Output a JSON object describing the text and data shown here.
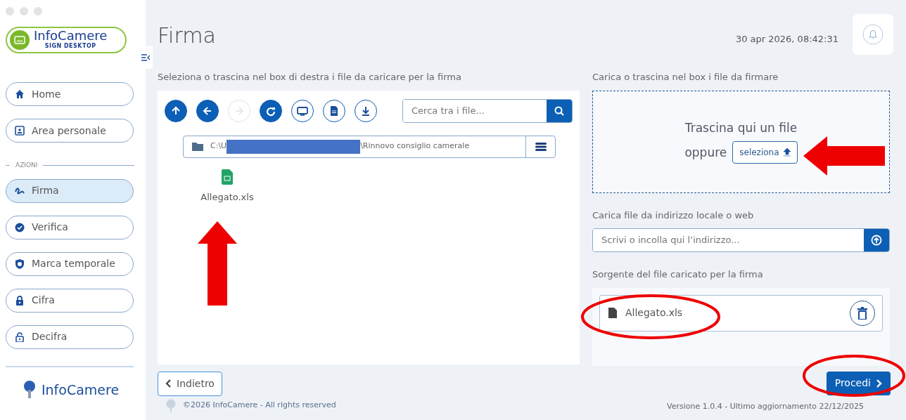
{
  "logo": {
    "title": "InfoCamere",
    "subtitle": "SIGN DESKTOP"
  },
  "sidebar": {
    "items": [
      {
        "label": "Home",
        "selected": false
      },
      {
        "label": "Area personale",
        "selected": false
      }
    ],
    "section": {
      "label": "AZIONI",
      "items": [
        {
          "label": "Firma",
          "selected": true
        },
        {
          "label": "Verifica",
          "selected": false
        },
        {
          "label": "Marca temporale",
          "selected": false
        },
        {
          "label": "Cifra",
          "selected": false
        },
        {
          "label": "Decifra",
          "selected": false
        }
      ]
    },
    "footer_logo": "InfoCamere"
  },
  "header": {
    "title": "Firma",
    "datetime": "30 apr 2026, 08:42:31"
  },
  "browser": {
    "instruction": "Seleziona o trascina nel box di destra i file da caricare per la firma",
    "toolbar": [
      {
        "kind": "filled",
        "disabled": false
      },
      {
        "kind": "filled",
        "disabled": false
      },
      {
        "kind": "outline",
        "disabled": true
      },
      {
        "kind": "filled",
        "disabled": false
      },
      {
        "kind": "outline",
        "disabled": false
      },
      {
        "kind": "outline",
        "disabled": false
      },
      {
        "kind": "outline",
        "disabled": false
      }
    ],
    "search_placeholder": "Cerca tra i file...",
    "path": {
      "start": "C:\\U",
      "end": "\\Rinnovo consiglio camerale"
    },
    "files": [
      {
        "name": "Allegato.xls"
      }
    ]
  },
  "upload": {
    "label": "Carica o trascina nel box i file da firmare",
    "drop_text": "Trascina qui un file",
    "or_text": "oppure",
    "select_button": "seleziona",
    "url_label": "Carica file da indirizzo locale o web",
    "url_placeholder": "Scrivi o incolla qui l’indirizzo...",
    "source_label": "Sorgente del file caricato per la firma",
    "loaded_files": [
      {
        "name": "Allegato.xls"
      }
    ]
  },
  "footer": {
    "back_button": "Indietro",
    "copyright": "©2026 InfoCamere - All rights reserved",
    "proceed_button": "Procedi",
    "version": "Versione 1.0.4 - Ultimo aggiornamento 22/12/2025"
  }
}
